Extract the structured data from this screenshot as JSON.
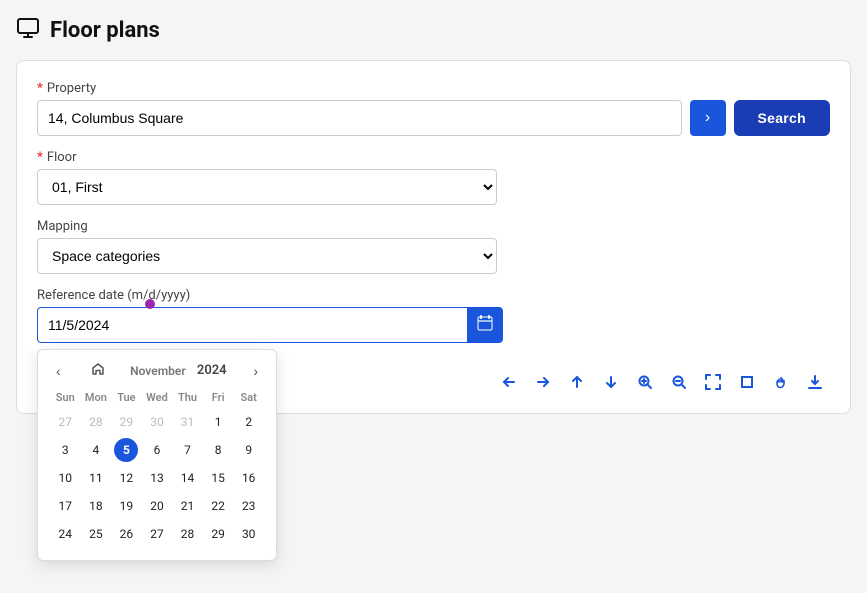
{
  "page": {
    "title": "Floor plans"
  },
  "form": {
    "property_label": "Property",
    "property_value": "14, Columbus Square",
    "floor_label": "Floor",
    "floor_value": "01, First",
    "mapping_label": "Mapping",
    "mapping_value": "Space categories",
    "mapping_options": [
      "Space categories"
    ],
    "ref_date_label": "Reference date (m/d/yyyy)",
    "ref_date_value": "11/5/2024",
    "ref_date_placeholder": "m/d/yyyy"
  },
  "calendar": {
    "month": "November",
    "year": "2024",
    "days_header": [
      "Sun",
      "Mon",
      "Tue",
      "Wed",
      "Thu",
      "Fri",
      "Sat"
    ],
    "weeks": [
      [
        {
          "day": 27,
          "other": true
        },
        {
          "day": 28,
          "other": true
        },
        {
          "day": 29,
          "other": true
        },
        {
          "day": 30,
          "other": true
        },
        {
          "day": 31,
          "other": true
        },
        {
          "day": 1
        },
        {
          "day": 2
        }
      ],
      [
        {
          "day": 3
        },
        {
          "day": 4
        },
        {
          "day": 5,
          "today": true
        },
        {
          "day": 6
        },
        {
          "day": 7
        },
        {
          "day": 8
        },
        {
          "day": 9
        }
      ],
      [
        {
          "day": 10
        },
        {
          "day": 11
        },
        {
          "day": 12
        },
        {
          "day": 13
        },
        {
          "day": 14
        },
        {
          "day": 15
        },
        {
          "day": 16
        }
      ],
      [
        {
          "day": 17
        },
        {
          "day": 18
        },
        {
          "day": 19
        },
        {
          "day": 20
        },
        {
          "day": 21
        },
        {
          "day": 22
        },
        {
          "day": 23
        }
      ],
      [
        {
          "day": 24
        },
        {
          "day": 25
        },
        {
          "day": 26
        },
        {
          "day": 27
        },
        {
          "day": 28
        },
        {
          "day": 29
        },
        {
          "day": 30
        }
      ]
    ]
  },
  "buttons": {
    "arrow_label": "›",
    "search_label": "Search",
    "calendar_icon": "📅"
  },
  "toolbar": {
    "icons": [
      {
        "name": "arrow-left-icon",
        "symbol": "←",
        "label": "Pan left"
      },
      {
        "name": "arrow-right-icon",
        "symbol": "→",
        "label": "Pan right"
      },
      {
        "name": "arrow-up-icon",
        "symbol": "↑",
        "label": "Pan up"
      },
      {
        "name": "arrow-down-icon",
        "symbol": "↓",
        "label": "Pan down"
      },
      {
        "name": "zoom-in-icon",
        "symbol": "⊕",
        "label": "Zoom in"
      },
      {
        "name": "zoom-out-icon",
        "symbol": "⊖",
        "label": "Zoom out"
      },
      {
        "name": "fullscreen-icon",
        "symbol": "⛶",
        "label": "Fullscreen"
      },
      {
        "name": "crop-icon",
        "symbol": "▣",
        "label": "Crop"
      },
      {
        "name": "hand-icon",
        "symbol": "✋",
        "label": "Hand"
      },
      {
        "name": "download-icon",
        "symbol": "⬇",
        "label": "Download"
      }
    ]
  }
}
